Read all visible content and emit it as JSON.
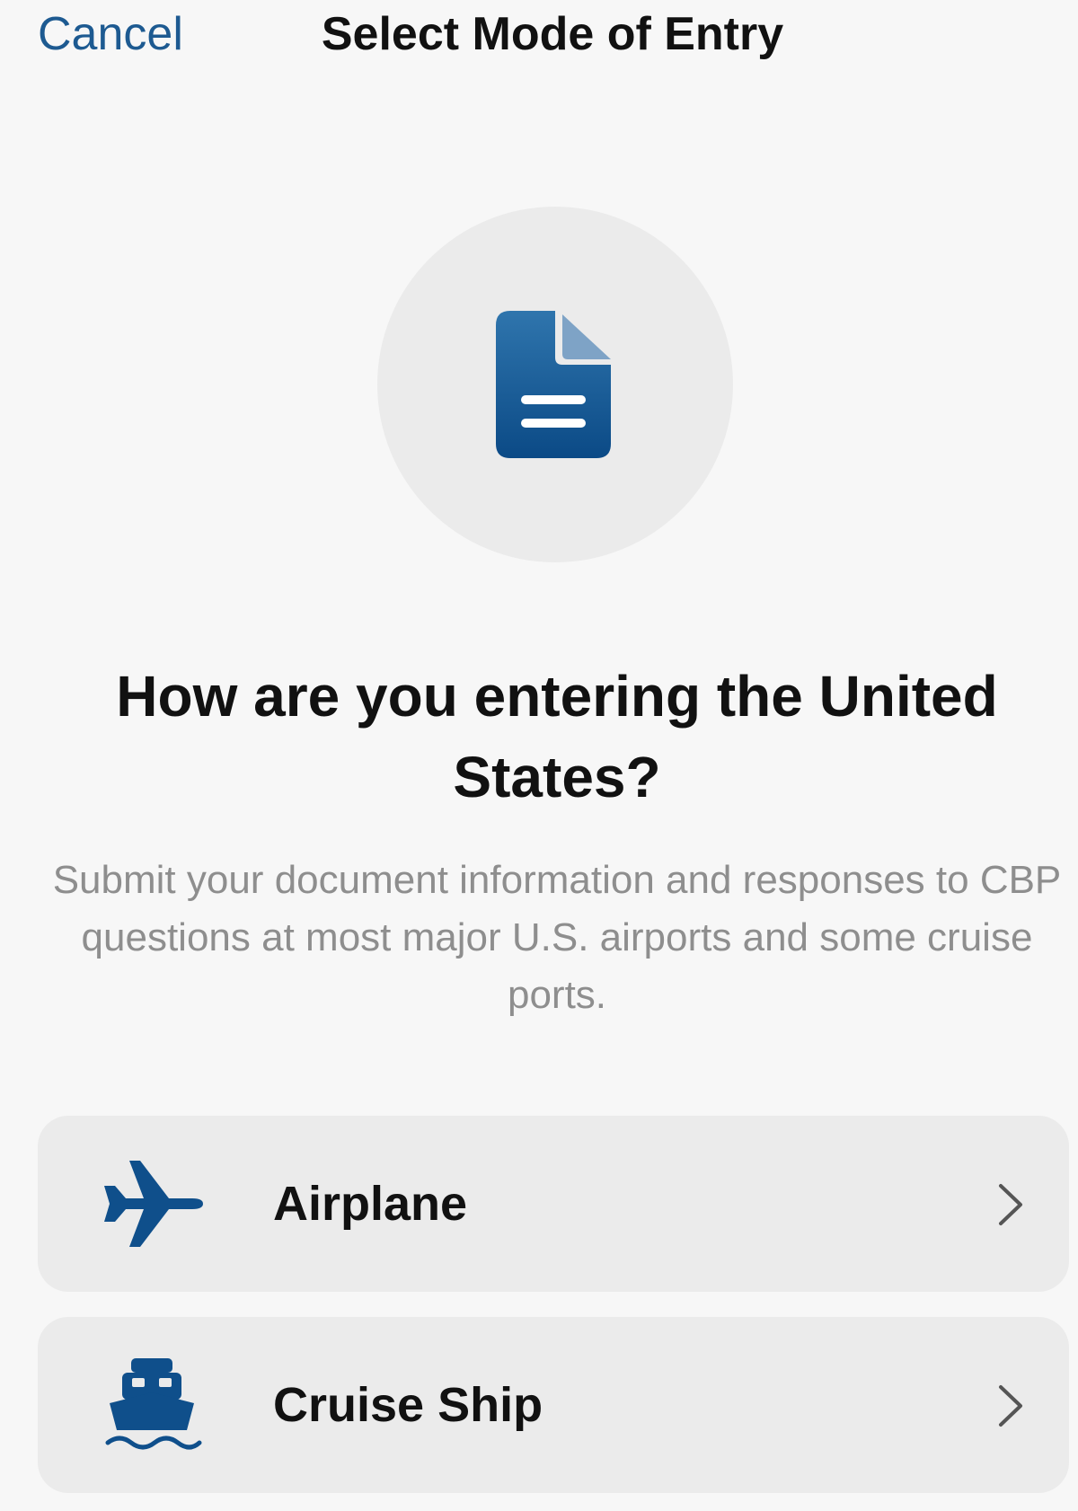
{
  "nav": {
    "cancel_label": "Cancel",
    "title": "Select Mode of Entry"
  },
  "hero": {
    "icon": "document-icon",
    "heading": "How are you entering the United States?",
    "description": "Submit your document information and responses to CBP questions at most major U.S. airports and some cruise ports."
  },
  "options": [
    {
      "label": "Airplane",
      "icon": "airplane-icon"
    },
    {
      "label": "Cruise Ship",
      "icon": "cruise-ship-icon"
    }
  ],
  "colors": {
    "accent": "#1d5a91",
    "icon_blue": "#0f4f8b",
    "card_bg": "#ebebeb",
    "page_bg": "#f7f7f7",
    "secondary_text": "#8e8e8e"
  }
}
